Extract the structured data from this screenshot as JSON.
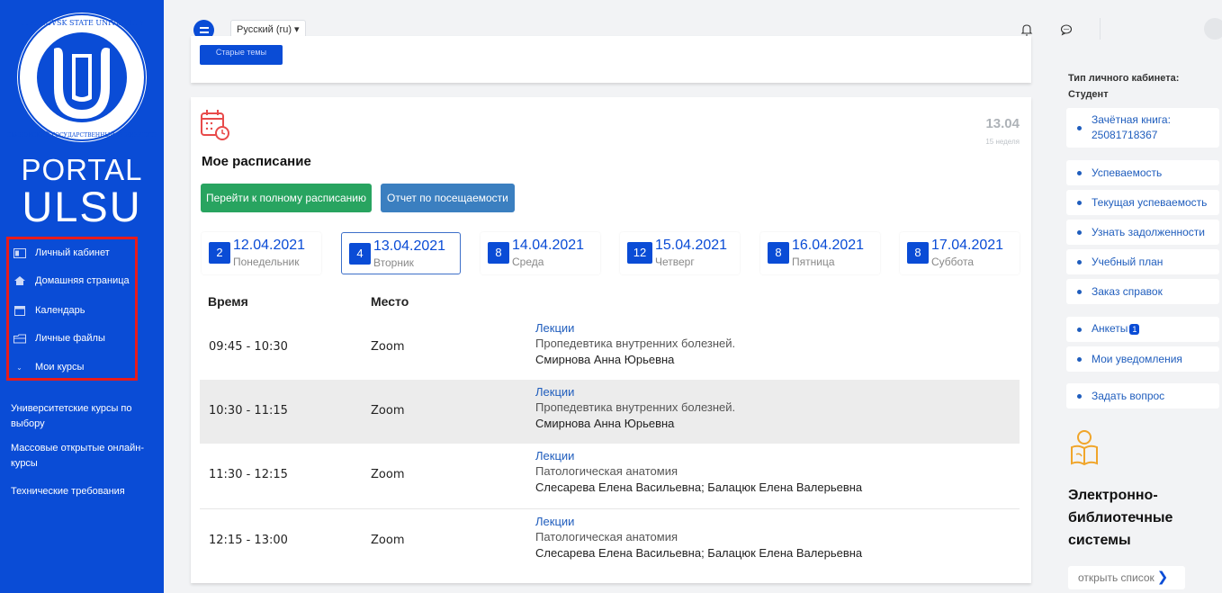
{
  "sidebar": {
    "logo": {
      "ring_text_top": "ULYANOVSK STATE UNIVERSITY",
      "ring_text_bottom": "УЛЬЯНОВСКИЙ ГОСУДАРСТВЕННЫЙ УНИВЕРСИТЕТ"
    },
    "brand_line1": "PORTAL",
    "brand_line2": "ULSU",
    "nav": [
      {
        "label": "Личный кабинет",
        "icon": "id-card-icon"
      },
      {
        "label": "Домашняя страница",
        "icon": "home-icon"
      },
      {
        "label": "Календарь",
        "icon": "calendar-icon"
      },
      {
        "label": "Личные файлы",
        "icon": "folder-icon"
      },
      {
        "label": "Мои курсы",
        "icon": "chevron-down-icon"
      }
    ],
    "links": [
      "Университетские курсы по выбору",
      "Массовые открытые онлайн-курсы",
      "Технические требования"
    ]
  },
  "topbar": {
    "language": "Русский (ru) ▾"
  },
  "top_card": {
    "button": "Старые темы"
  },
  "schedule": {
    "date": "13.04",
    "week": "15 неделя",
    "title": "Мое расписание",
    "btn_full": "Перейти к полному расписанию",
    "btn_attendance": "Отчет по посещаемости",
    "days": [
      {
        "count": "2",
        "date": "12.04.2021",
        "weekday": "Понедельник"
      },
      {
        "count": "4",
        "date": "13.04.2021",
        "weekday": "Вторник"
      },
      {
        "count": "8",
        "date": "14.04.2021",
        "weekday": "Среда"
      },
      {
        "count": "12",
        "date": "15.04.2021",
        "weekday": "Четверг"
      },
      {
        "count": "8",
        "date": "16.04.2021",
        "weekday": "Пятница"
      },
      {
        "count": "8",
        "date": "17.04.2021",
        "weekday": "Суббота"
      }
    ],
    "col_time": "Время",
    "col_place": "Место",
    "rows": [
      {
        "time": "09:45 - 10:30",
        "place": "Zoom",
        "kind": "Лекции",
        "subject": "Пропедевтика внутренних болезней.",
        "teacher": "Смирнова Анна Юрьевна"
      },
      {
        "time": "10:30 - 11:15",
        "place": "Zoom",
        "kind": "Лекции",
        "subject": "Пропедевтика внутренних болезней.",
        "teacher": "Смирнова Анна Юрьевна"
      },
      {
        "time": "11:30 - 12:15",
        "place": "Zoom",
        "kind": "Лекции",
        "subject": "Патологическая анатомия",
        "teacher": "Слесарева Елена Васильевна; Балацюк Елена Валерьевна"
      },
      {
        "time": "12:15 - 13:00",
        "place": "Zoom",
        "kind": "Лекции",
        "subject": "Патологическая анатомия",
        "teacher": "Слесарева Елена Васильевна; Балацюк Елена Валерьевна"
      }
    ]
  },
  "right_panel": {
    "type_label": "Тип личного кабинета:",
    "type_value": "Студент",
    "record_book_label": "Зачётная книга:",
    "record_book_number": "25081718367",
    "links": [
      "Успеваемость",
      "Текущая успеваемость",
      "Узнать задолженности",
      "Учебный план",
      "Заказ справок"
    ],
    "surveys_label": "Анкеты",
    "surveys_badge": "1",
    "notifications": "Мои уведомления",
    "ask": "Задать вопрос",
    "library_title": "Электронно-библиотечные системы",
    "open_list": "открыть список"
  },
  "colors": {
    "brand_blue": "#0a4cd6",
    "green": "#28a460",
    "steel_blue": "#3b7fc0",
    "highlight_red": "#e81b1b"
  }
}
